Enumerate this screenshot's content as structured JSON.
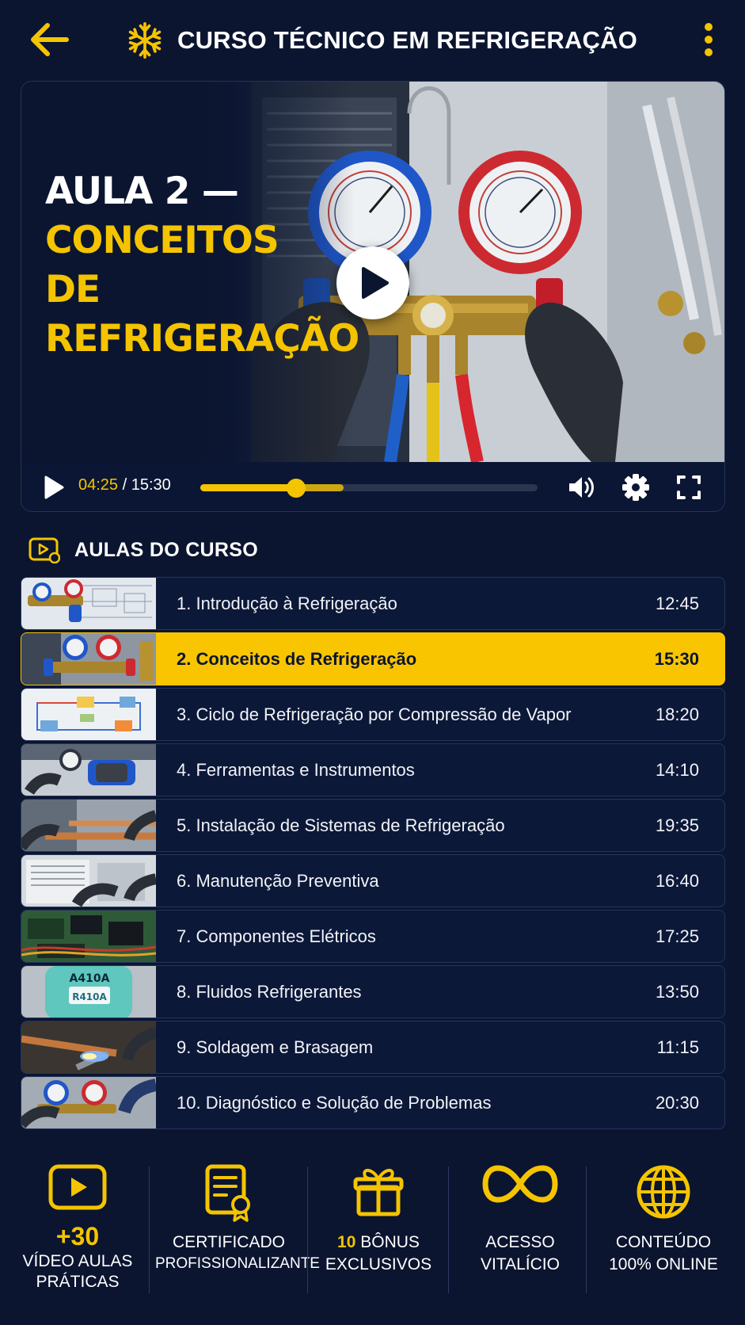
{
  "header": {
    "title": "CURSO TÉCNICO EM REFRIGERAÇÃO"
  },
  "video": {
    "overlay_line1": "AULA 2 —",
    "overlay_line2": "CONCEITOS DE REFRIGERAÇÃO",
    "current_time": "04:25",
    "time_separator": "/",
    "total_time": "15:30",
    "progress_fraction": 0.285
  },
  "section": {
    "title": "AULAS DO CURSO"
  },
  "lessons": [
    {
      "label": "1. Introdução à Refrigeração",
      "duration": "12:45"
    },
    {
      "label": "2. Conceitos de Refrigeração",
      "duration": "15:30"
    },
    {
      "label": "3. Ciclo de Refrigeração por Compressão de Vapor",
      "duration": "18:20"
    },
    {
      "label": "4. Ferramentas e Instrumentos",
      "duration": "14:10"
    },
    {
      "label": "5. Instalação de Sistemas de Refrigeração",
      "duration": "19:35"
    },
    {
      "label": "6. Manutenção Preventiva",
      "duration": "16:40"
    },
    {
      "label": "7. Componentes Elétricos",
      "duration": "17:25"
    },
    {
      "label": "8. Fluidos Refrigerantes",
      "duration": "13:50"
    },
    {
      "label": "9. Soldagem e Brasagem",
      "duration": "11:15"
    },
    {
      "label": "10. Diagnóstico e Solução de Problemas",
      "duration": "20:30"
    }
  ],
  "active_lesson": 2,
  "features": {
    "videos": {
      "number": "+30",
      "line1": "VÍDEO AULAS",
      "line2": "PRÁTICAS"
    },
    "certificate": {
      "line1": "CERTIFICADO",
      "line2": "PROFISSIONALIZANTE"
    },
    "bonus": {
      "number": "10",
      "word": "BÔNUS",
      "line2": "EXCLUSIVOS"
    },
    "access": {
      "line1": "ACESSO",
      "line2": "VITALÍCIO"
    },
    "content": {
      "line1": "CONTEÚDO",
      "line2": "100% ONLINE"
    }
  },
  "thumb_labels": {
    "lesson8_can_top": "A410A",
    "lesson8_can_label": "R410A"
  },
  "colors": {
    "background": "#0b1530",
    "accent": "#f5c400",
    "card": "#0c1838",
    "border": "#25355a"
  },
  "icons": [
    "back-arrow-icon",
    "snowflake-icon",
    "more-vertical-icon",
    "play-icon",
    "volume-icon",
    "gear-icon",
    "fullscreen-icon",
    "video-list-icon",
    "certificate-icon",
    "gift-icon",
    "infinity-icon",
    "globe-icon"
  ]
}
